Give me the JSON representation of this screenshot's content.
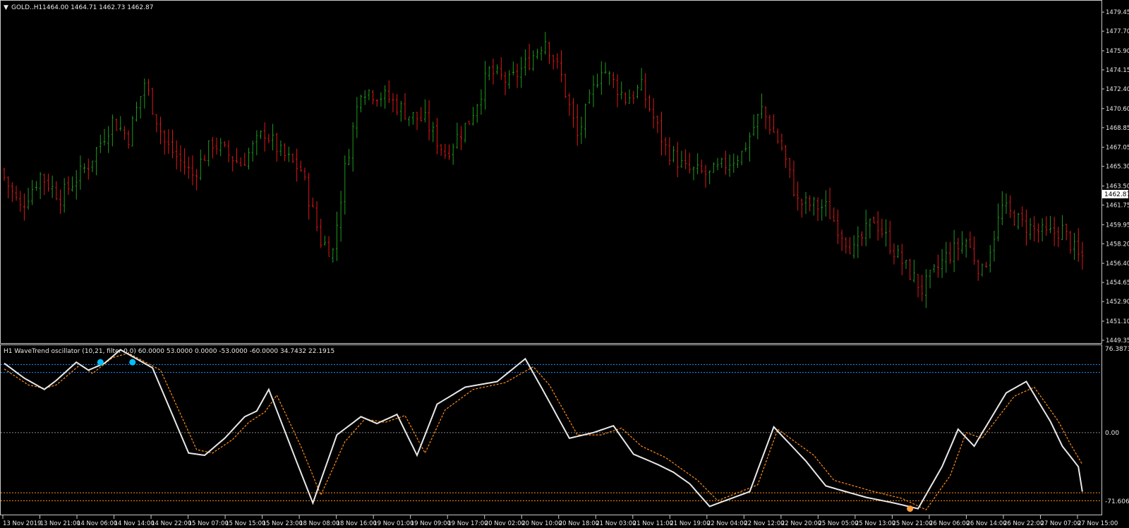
{
  "colors": {
    "bull": "#1e9a1e",
    "bear": "#e01818",
    "grid_frame": "#c8c8c8",
    "wt1": "#e8e8e8",
    "wt2": "#ff8c1a",
    "ob_level": "#1e90ff",
    "os_level": "#ff8c1a",
    "dot_buy": "#00bfff",
    "dot_sell": "#ffa040",
    "zero": "#888888"
  },
  "main_chart": {
    "title": "GOLD..H1",
    "ohlc": "1464.00 1464.71 1462.73 1462.87",
    "price_labels": [
      "1479.45",
      "1477.70",
      "1475.90",
      "1474.15",
      "1472.40",
      "1470.60",
      "1468.85",
      "1467.05",
      "1465.30",
      "1463.50",
      "1461.75",
      "1459.95",
      "1458.20",
      "1456.40",
      "1454.65",
      "1452.90",
      "1451.10",
      "1449.35"
    ],
    "current_price": "1462.87"
  },
  "indicator": {
    "title": "H1 WaveTrend oscillator (10,21, filter 0.0) 60.0000 53.0000 0.0000 -53.0000 -60.0000 34.7432 22.1915",
    "scale_labels": [
      "76.3873",
      "0.00",
      "-71.606"
    ]
  },
  "time_axis": [
    "13 Nov 2019",
    "13 Nov 21:00",
    "14 Nov 06:00",
    "14 Nov 14:00",
    "14 Nov 22:00",
    "15 Nov 07:00",
    "15 Nov 15:00",
    "15 Nov 23:00",
    "18 Nov 08:00",
    "18 Nov 16:00",
    "19 Nov 01:00",
    "19 Nov 09:00",
    "19 Nov 17:00",
    "20 Nov 02:00",
    "20 Nov 10:00",
    "20 Nov 18:00",
    "21 Nov 03:00",
    "21 Nov 11:00",
    "21 Nov 19:00",
    "22 Nov 04:00",
    "22 Nov 12:00",
    "22 Nov 20:00",
    "25 Nov 05:00",
    "25 Nov 13:00",
    "25 Nov 21:00",
    "26 Nov 06:00",
    "26 Nov 14:00",
    "26 Nov 22:00",
    "27 Nov 07:00",
    "27 Nov 15:00"
  ],
  "chart_data": {
    "type": "candlestick",
    "price_path": [
      [
        0,
        1465.0
      ],
      [
        5,
        1461.5
      ],
      [
        10,
        1464.5
      ],
      [
        15,
        1462.5
      ],
      [
        22,
        1465.5
      ],
      [
        28,
        1469.5
      ],
      [
        32,
        1468.0
      ],
      [
        36,
        1473.0
      ],
      [
        41,
        1467.5
      ],
      [
        48,
        1464.5
      ],
      [
        53,
        1467.5
      ],
      [
        60,
        1465.5
      ],
      [
        66,
        1468.5
      ],
      [
        70,
        1466.5
      ],
      [
        75,
        1465.0
      ],
      [
        80,
        1458.5
      ],
      [
        83,
        1457.5
      ],
      [
        86,
        1465.0
      ],
      [
        90,
        1472.5
      ],
      [
        97,
        1471.5
      ],
      [
        102,
        1470.0
      ],
      [
        106,
        1469.5
      ],
      [
        111,
        1466.5
      ],
      [
        117,
        1469.5
      ],
      [
        122,
        1474.0
      ],
      [
        127,
        1473.0
      ],
      [
        132,
        1475.0
      ],
      [
        136,
        1477.0
      ],
      [
        140,
        1473.5
      ],
      [
        144,
        1468.0
      ],
      [
        150,
        1474.5
      ],
      [
        156,
        1471.5
      ],
      [
        160,
        1472.5
      ],
      [
        166,
        1467.0
      ],
      [
        171,
        1465.0
      ],
      [
        177,
        1464.5
      ],
      [
        185,
        1466.5
      ],
      [
        190,
        1470.5
      ],
      [
        195,
        1467.0
      ],
      [
        199,
        1462.0
      ],
      [
        206,
        1461.5
      ],
      [
        213,
        1457.5
      ],
      [
        218,
        1460.5
      ],
      [
        224,
        1457.0
      ],
      [
        230,
        1454.0
      ],
      [
        236,
        1457.0
      ],
      [
        241,
        1458.5
      ],
      [
        245,
        1455.5
      ],
      [
        250,
        1461.5
      ],
      [
        255,
        1460.0
      ],
      [
        261,
        1459.0
      ],
      [
        265,
        1459.5
      ],
      [
        269,
        1457.0
      ]
    ],
    "wt1_path": [
      [
        0,
        61
      ],
      [
        5,
        48
      ],
      [
        10,
        38
      ],
      [
        13,
        46
      ],
      [
        18,
        62
      ],
      [
        21,
        55
      ],
      [
        25,
        61
      ],
      [
        29,
        73
      ],
      [
        37,
        57
      ],
      [
        46,
        -18
      ],
      [
        50,
        -20
      ],
      [
        55,
        -5
      ],
      [
        60,
        14
      ],
      [
        63,
        19
      ],
      [
        66,
        38
      ],
      [
        72,
        -17
      ],
      [
        77,
        -62
      ],
      [
        83,
        -2
      ],
      [
        89,
        14
      ],
      [
        93,
        8
      ],
      [
        98,
        16
      ],
      [
        103,
        -20
      ],
      [
        108,
        25
      ],
      [
        115,
        40
      ],
      [
        123,
        45
      ],
      [
        130,
        65
      ],
      [
        134,
        40
      ],
      [
        141,
        -5
      ],
      [
        147,
        0
      ],
      [
        152,
        6
      ],
      [
        157,
        -19
      ],
      [
        163,
        -28
      ],
      [
        167,
        -35
      ],
      [
        171,
        -45
      ],
      [
        176,
        -65
      ],
      [
        186,
        -52
      ],
      [
        192,
        5
      ],
      [
        200,
        -25
      ],
      [
        205,
        -47
      ],
      [
        215,
        -57
      ],
      [
        222,
        -62
      ],
      [
        228,
        -67
      ],
      [
        234,
        -30
      ],
      [
        238,
        3
      ],
      [
        242,
        -12
      ],
      [
        250,
        35
      ],
      [
        255,
        45
      ],
      [
        261,
        10
      ],
      [
        264,
        -12
      ],
      [
        268,
        -30
      ],
      [
        269,
        -52
      ]
    ],
    "wt2_path": [
      [
        0,
        56
      ],
      [
        6,
        42
      ],
      [
        10,
        39
      ],
      [
        13,
        42
      ],
      [
        19,
        60
      ],
      [
        22,
        52
      ],
      [
        27,
        66
      ],
      [
        31,
        70
      ],
      [
        39,
        55
      ],
      [
        48,
        -15
      ],
      [
        52,
        -18
      ],
      [
        57,
        -6
      ],
      [
        61,
        9
      ],
      [
        65,
        18
      ],
      [
        68,
        33
      ],
      [
        74,
        -12
      ],
      [
        79,
        -55
      ],
      [
        85,
        -8
      ],
      [
        90,
        12
      ],
      [
        95,
        9
      ],
      [
        100,
        15
      ],
      [
        105,
        -18
      ],
      [
        110,
        20
      ],
      [
        117,
        38
      ],
      [
        125,
        44
      ],
      [
        132,
        58
      ],
      [
        136,
        42
      ],
      [
        143,
        -2
      ],
      [
        149,
        -2
      ],
      [
        154,
        4
      ],
      [
        159,
        -12
      ],
      [
        165,
        -22
      ],
      [
        169,
        -32
      ],
      [
        173,
        -42
      ],
      [
        178,
        -60
      ],
      [
        188,
        -46
      ],
      [
        193,
        3
      ],
      [
        202,
        -20
      ],
      [
        207,
        -42
      ],
      [
        217,
        -52
      ],
      [
        224,
        -58
      ],
      [
        230,
        -68
      ],
      [
        236,
        -38
      ],
      [
        240,
        0
      ],
      [
        244,
        -5
      ],
      [
        252,
        32
      ],
      [
        257,
        40
      ],
      [
        263,
        10
      ],
      [
        266,
        -10
      ],
      [
        269,
        -28
      ]
    ],
    "levels": [
      60,
      53,
      0,
      -53,
      -60
    ],
    "signals": [
      {
        "bar": 24,
        "value": 62,
        "side": "buy"
      },
      {
        "bar": 32,
        "value": 62,
        "side": "buy"
      },
      {
        "bar": 226,
        "value": -67,
        "side": "sell"
      }
    ],
    "bars": 270,
    "price_range": [
      1449.35,
      1480.3
    ],
    "osc_range": [
      -71.606,
      76.3873
    ]
  }
}
